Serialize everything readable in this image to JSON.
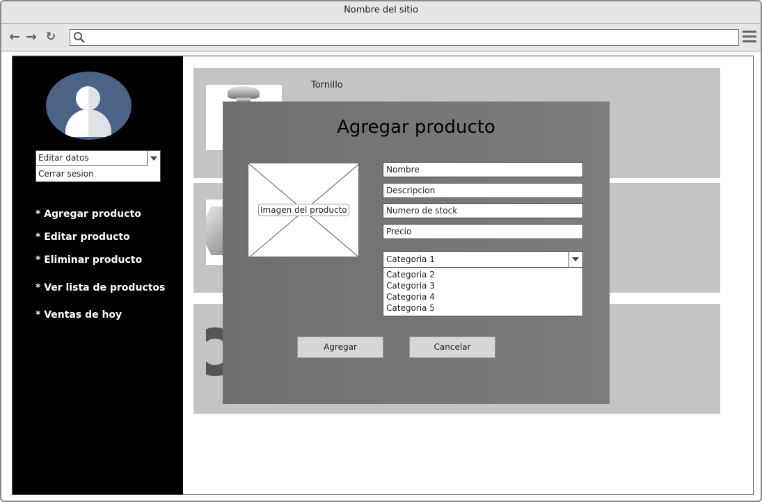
{
  "browser": {
    "title": "Nombre del sitio",
    "address_value": ""
  },
  "sidebar": {
    "user_menu": {
      "selected": "Editar datos",
      "option": "Cerrar sesion"
    },
    "links": [
      "* Agregar producto",
      "* Editar producto",
      "* Eliminar producto",
      "* Ver lista de productos",
      "* Ventas de hoy"
    ]
  },
  "products": [
    {
      "name": "Tornillo"
    },
    {
      "name": ""
    },
    {
      "name": ""
    }
  ],
  "modal": {
    "title": "Agregar producto",
    "image_caption": "Imagen del producto",
    "fields": {
      "nombre": "Nombre",
      "descripcion": "Descripcion",
      "stock": "Numero de stock",
      "precio": "Precio"
    },
    "category": {
      "selected": "Categoria 1",
      "options": [
        "Categoria 2",
        "Categoria 3",
        "Categoria 4",
        "Categoria 5"
      ]
    },
    "add_label": "Agregar",
    "cancel_label": "Cancelar"
  },
  "colors": {
    "sidebar": "#000000",
    "avatar": "#4b6386",
    "card": "#c4c4c4",
    "modal": "#777777"
  }
}
